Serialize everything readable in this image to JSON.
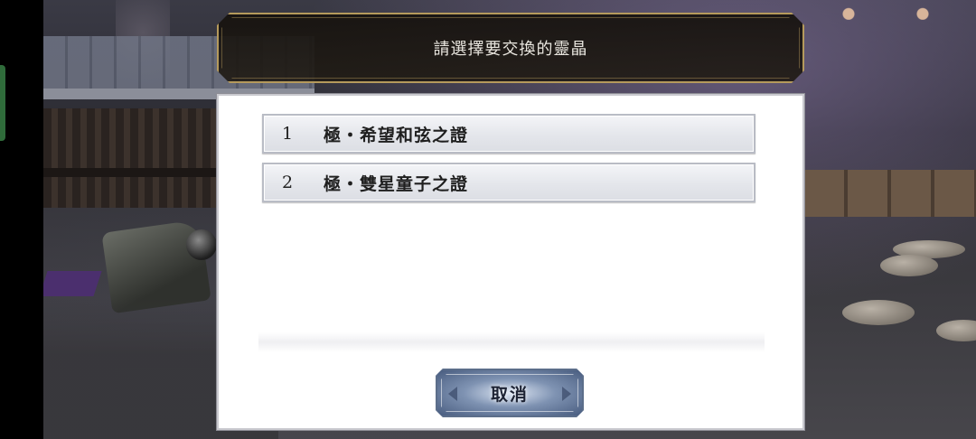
{
  "dialog": {
    "title": "請選擇要交換的靈晶",
    "options": [
      {
        "number": "1",
        "label": "極・希望和弦之證"
      },
      {
        "number": "2",
        "label": "極・雙星童子之證"
      }
    ],
    "cancel_label": "取消"
  },
  "colors": {
    "title_border": "#b59a5c",
    "panel_bg": "#ffffff",
    "cancel_button": "#5b6f91"
  }
}
